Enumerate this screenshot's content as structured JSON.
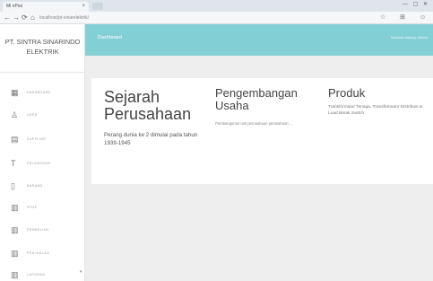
{
  "browser": {
    "tab_title": "Mi nPoo",
    "tab_close": "×",
    "url": "localhost/pt-sinarelektrik/",
    "window_controls": "—  ▢  ✕",
    "back_icon": "arrow-left",
    "forward_icon": "arrow-right",
    "reload_icon": "reload"
  },
  "sidebar": {
    "brand_line1": "PT. SINTRA SINARINDO",
    "brand_line2": "ELEKTRIK",
    "items": [
      {
        "label": "DASHBOARD",
        "icon": "dashboard-icon",
        "glyph": "▦"
      },
      {
        "label": "USER",
        "icon": "user-icon",
        "glyph": "♙"
      },
      {
        "label": "SUPPLIER",
        "icon": "supplier-icon",
        "glyph": "▤"
      },
      {
        "label": "PELANGGAN",
        "icon": "customer-icon",
        "glyph": "T"
      },
      {
        "label": "BARANG",
        "icon": "item-icon",
        "glyph": "▯"
      },
      {
        "label": "STOK",
        "icon": "stock-icon",
        "glyph": "▥"
      },
      {
        "label": "PEMBELIAN",
        "icon": "purchase-icon",
        "glyph": "▥"
      },
      {
        "label": "PENJUALAN",
        "icon": "sales-icon",
        "glyph": "▥"
      },
      {
        "label": "LAPORAN",
        "icon": "report-icon",
        "glyph": "▥"
      }
    ]
  },
  "header": {
    "title": "Dashboard",
    "welcome": "Selamat datang, Admin"
  },
  "main": {
    "sections": [
      {
        "title": "Sejarah Perusahaan",
        "text": "Perang dunia ke 2 dimulai pada tahun 1939-1945"
      },
      {
        "title": "Pengembangan Usaha",
        "text": "Pembangunan unit perusahaan perusahaan ..."
      },
      {
        "title": "Produk",
        "text": "Transformator Tenaga, Transformator Distribusi & Load Break Switch"
      }
    ]
  }
}
